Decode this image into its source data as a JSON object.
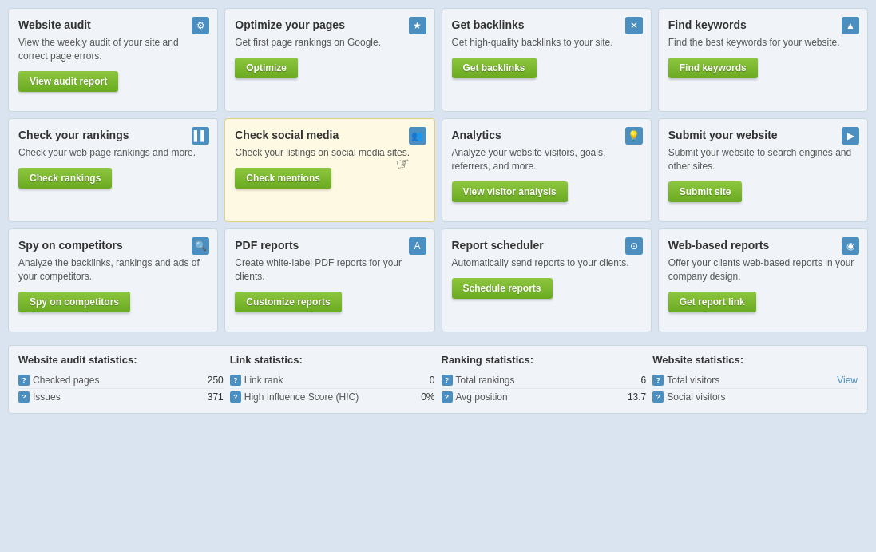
{
  "cards": [
    {
      "id": "website-audit",
      "title": "Website audit",
      "desc": "View the weekly audit of your site and correct page errors.",
      "btn": "View audit report",
      "icon": "⚙",
      "highlighted": false
    },
    {
      "id": "optimize-pages",
      "title": "Optimize your pages",
      "desc": "Get first page rankings on Google.",
      "btn": "Optimize",
      "icon": "★",
      "highlighted": false
    },
    {
      "id": "get-backlinks",
      "title": "Get backlinks",
      "desc": "Get high-quality backlinks to your site.",
      "btn": "Get backlinks",
      "icon": "✕",
      "highlighted": false
    },
    {
      "id": "find-keywords",
      "title": "Find keywords",
      "desc": "Find the best keywords for your website.",
      "btn": "Find keywords",
      "icon": "▲",
      "highlighted": false
    },
    {
      "id": "check-rankings",
      "title": "Check your rankings",
      "desc": "Check your web page rankings and more.",
      "btn": "Check rankings",
      "icon": "📊",
      "highlighted": false
    },
    {
      "id": "check-social-media",
      "title": "Check social media",
      "desc": "Check your listings on social media sites.",
      "btn": "Check mentions",
      "icon": "👥",
      "highlighted": true
    },
    {
      "id": "analytics",
      "title": "Analytics",
      "desc": "Analyze your website visitors, goals, referrers, and more.",
      "btn": "View visitor analysis",
      "icon": "💡",
      "highlighted": false
    },
    {
      "id": "submit-website",
      "title": "Submit your website",
      "desc": "Submit your website to search engines and other sites.",
      "btn": "Submit site",
      "icon": "▶",
      "highlighted": false
    },
    {
      "id": "spy-competitors",
      "title": "Spy on competitors",
      "desc": "Analyze the backlinks, rankings and ads of your competitors.",
      "btn": "Spy on competitors",
      "icon": "🔍",
      "highlighted": false
    },
    {
      "id": "pdf-reports",
      "title": "PDF reports",
      "desc": "Create white-label PDF reports for your clients.",
      "btn": "Customize reports",
      "icon": "A",
      "highlighted": false
    },
    {
      "id": "report-scheduler",
      "title": "Report scheduler",
      "desc": "Automatically send reports to your clients.",
      "btn": "Schedule reports",
      "icon": "⏱",
      "highlighted": false
    },
    {
      "id": "web-based-reports",
      "title": "Web-based reports",
      "desc": "Offer your clients web-based reports in your company design.",
      "btn": "Get report link",
      "icon": "🌐",
      "highlighted": false
    }
  ],
  "stats": {
    "sections": [
      {
        "title": "Website audit statistics:",
        "rows": [
          {
            "label": "Checked pages",
            "value": "250",
            "link": false
          },
          {
            "label": "Issues",
            "value": "371",
            "link": false
          }
        ]
      },
      {
        "title": "Link statistics:",
        "rows": [
          {
            "label": "Link rank",
            "value": "0",
            "link": false
          },
          {
            "label": "High Influence Score (HIC)",
            "value": "0%",
            "link": false
          }
        ]
      },
      {
        "title": "Ranking statistics:",
        "rows": [
          {
            "label": "Total rankings",
            "value": "6",
            "link": false
          },
          {
            "label": "Avg position",
            "value": "13.7",
            "link": false
          }
        ]
      },
      {
        "title": "Website statistics:",
        "rows": [
          {
            "label": "Total visitors",
            "value": "View",
            "link": true
          },
          {
            "label": "Social visitors",
            "value": "",
            "link": false
          }
        ]
      }
    ]
  }
}
